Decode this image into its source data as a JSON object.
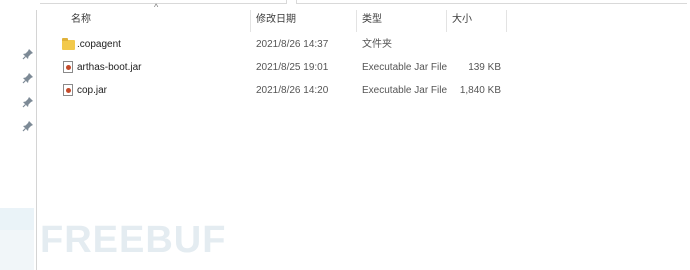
{
  "columns": {
    "name": "名称",
    "date": "修改日期",
    "type": "类型",
    "size": "大小",
    "sort_indicator": "^"
  },
  "nav": {
    "pins": [
      "pin-icon",
      "pin-icon",
      "pin-icon",
      "pin-icon"
    ]
  },
  "files": [
    {
      "icon": "folder-icon",
      "name": ".copagent",
      "date": "2021/8/26 14:37",
      "type": "文件夹",
      "size": ""
    },
    {
      "icon": "jar-file-icon",
      "name": "arthas-boot.jar",
      "date": "2021/8/25 19:01",
      "type": "Executable Jar File",
      "size": "139 KB"
    },
    {
      "icon": "jar-file-icon",
      "name": "cop.jar",
      "date": "2021/8/26 14:20",
      "type": "Executable Jar File",
      "size": "1,840 KB"
    }
  ],
  "watermark": {
    "text": "FREEBUF"
  },
  "colors": {
    "folder": "#f2c94c",
    "watermark": "#e4ecf1"
  }
}
